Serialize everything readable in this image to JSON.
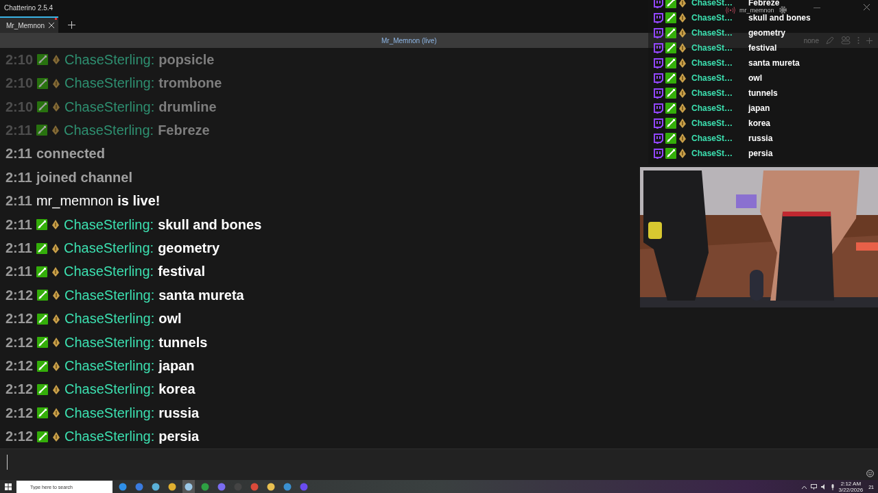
{
  "window": {
    "title": "Chatterino 2.5.4"
  },
  "tabs": [
    {
      "label": "Mr_Memnon",
      "selected": true,
      "unread": true
    }
  ],
  "split_header": {
    "title": "Mr_Memnon (live)",
    "mode": "none"
  },
  "messages": [
    {
      "kind": "chat",
      "time": "2:10",
      "faded": true,
      "user": "ChaseSterling:",
      "text": "popsicle"
    },
    {
      "kind": "chat",
      "time": "2:10",
      "faded": true,
      "user": "ChaseSterling:",
      "text": "trombone"
    },
    {
      "kind": "chat",
      "time": "2:10",
      "faded": true,
      "user": "ChaseSterling:",
      "text": "drumline"
    },
    {
      "kind": "chat",
      "time": "2:11",
      "faded": true,
      "user": "ChaseSterling:",
      "text": "Febreze"
    },
    {
      "kind": "system",
      "time": "2:11",
      "text": "connected"
    },
    {
      "kind": "system",
      "time": "2:11",
      "text": "joined channel"
    },
    {
      "kind": "live",
      "time": "2:11",
      "user": "mr_memnon",
      "text": "is live!"
    },
    {
      "kind": "chat",
      "time": "2:11",
      "faded": false,
      "user": "ChaseSterling:",
      "text": "skull and bones"
    },
    {
      "kind": "chat",
      "time": "2:11",
      "faded": false,
      "user": "ChaseSterling:",
      "text": "geometry"
    },
    {
      "kind": "chat",
      "time": "2:11",
      "faded": false,
      "user": "ChaseSterling:",
      "text": "festival"
    },
    {
      "kind": "chat",
      "time": "2:12",
      "faded": false,
      "user": "ChaseSterling:",
      "text": "santa mureta"
    },
    {
      "kind": "chat",
      "time": "2:12",
      "faded": false,
      "user": "ChaseSterling:",
      "text": "owl"
    },
    {
      "kind": "chat",
      "time": "2:12",
      "faded": false,
      "user": "ChaseSterling:",
      "text": "tunnels"
    },
    {
      "kind": "chat",
      "time": "2:12",
      "faded": false,
      "user": "ChaseSterling:",
      "text": "japan"
    },
    {
      "kind": "chat",
      "time": "2:12",
      "faded": false,
      "user": "ChaseSterling:",
      "text": "korea"
    },
    {
      "kind": "chat",
      "time": "2:12",
      "faded": false,
      "user": "ChaseSterling:",
      "text": "russia"
    },
    {
      "kind": "chat",
      "time": "2:12",
      "faded": false,
      "user": "ChaseSterling:",
      "text": "persia"
    }
  ],
  "overlay": {
    "title": "mr_memnon",
    "rows": [
      {
        "user": "ChaseSt…",
        "text": "Febreze"
      },
      {
        "user": "ChaseSt…",
        "text": "skull and bones"
      },
      {
        "user": "ChaseSt…",
        "text": "geometry"
      },
      {
        "user": "ChaseSt…",
        "text": "festival"
      },
      {
        "user": "ChaseSt…",
        "text": "santa mureta"
      },
      {
        "user": "ChaseSt…",
        "text": "owl"
      },
      {
        "user": "ChaseSt…",
        "text": "tunnels"
      },
      {
        "user": "ChaseSt…",
        "text": "japan"
      },
      {
        "user": "ChaseSt…",
        "text": "korea"
      },
      {
        "user": "ChaseSt…",
        "text": "russia"
      },
      {
        "user": "ChaseSt…",
        "text": "persia"
      }
    ]
  },
  "taskbar": {
    "search_placeholder": "Type here to search",
    "time": "2:12 AM",
    "date": "3/22/2026",
    "notifications": "21"
  }
}
